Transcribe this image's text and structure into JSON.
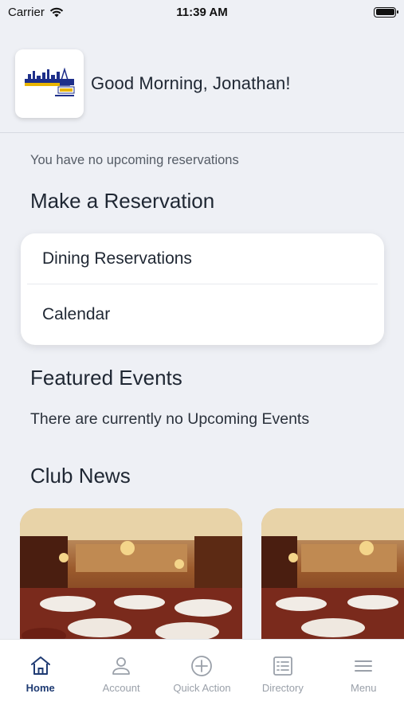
{
  "status_bar": {
    "carrier": "Carrier",
    "time": "11:39 AM"
  },
  "header": {
    "greeting": "Good Morning, Jonathan!"
  },
  "reservations": {
    "empty_text": "You have no upcoming reservations",
    "section_title": "Make a Reservation",
    "options": [
      "Dining Reservations",
      "Calendar"
    ]
  },
  "events": {
    "section_title": "Featured Events",
    "empty_text": "There are currently no Upcoming Events"
  },
  "news": {
    "section_title": "Club News"
  },
  "tab_bar": {
    "tabs": [
      {
        "label": "Home",
        "icon": "home-icon",
        "active": true
      },
      {
        "label": "Account",
        "icon": "person-icon",
        "active": false
      },
      {
        "label": "Quick Action",
        "icon": "plus-circle-icon",
        "active": false
      },
      {
        "label": "Directory",
        "icon": "list-icon",
        "active": false
      },
      {
        "label": "Menu",
        "icon": "hamburger-icon",
        "active": false
      }
    ]
  },
  "colors": {
    "active_tab": "#1f3b73",
    "inactive_tab": "#9aa0a9",
    "background": "#eef0f5"
  }
}
